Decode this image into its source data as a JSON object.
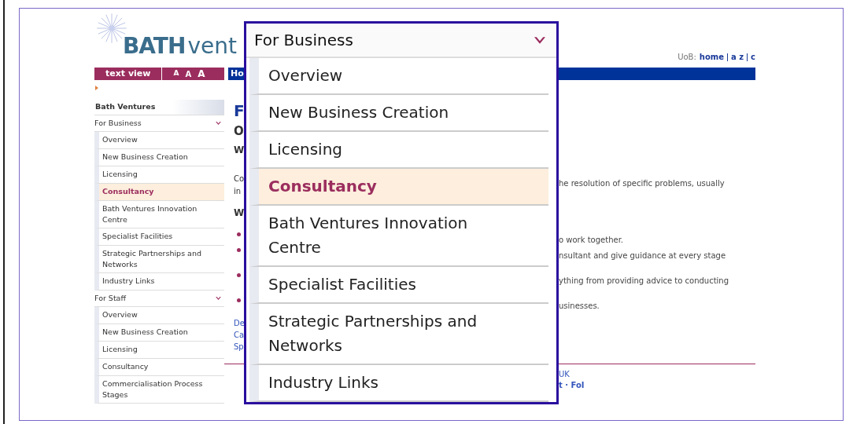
{
  "logo": {
    "strong": "BATH",
    "light": "vent"
  },
  "utility": {
    "label": "UoB:",
    "links": [
      "home",
      "a z",
      "c"
    ]
  },
  "toolbar": {
    "text_view": "text view",
    "sizes": [
      "A",
      "A",
      "A"
    ],
    "nav": "Ho"
  },
  "sidebar": {
    "title": "Bath Ventures",
    "groups": [
      {
        "label": "For Business",
        "expanded": true,
        "children": [
          {
            "label": "Overview",
            "selected": false
          },
          {
            "label": "New Business Creation",
            "selected": false
          },
          {
            "label": "Licensing",
            "selected": false
          },
          {
            "label": "Consultancy",
            "selected": true
          },
          {
            "label": "Bath Ventures Innovation Centre",
            "selected": false
          },
          {
            "label": "Specialist Facilities",
            "selected": false
          },
          {
            "label": "Strategic Partnerships and Networks",
            "selected": false
          },
          {
            "label": "Industry Links",
            "selected": false
          }
        ]
      },
      {
        "label": "For Staff",
        "expanded": true,
        "children": [
          {
            "label": "Overview",
            "selected": false
          },
          {
            "label": "New Business Creation",
            "selected": false
          },
          {
            "label": "Licensing",
            "selected": false
          },
          {
            "label": "Consultancy",
            "selected": false
          },
          {
            "label": "Commercialisation Process Stages",
            "selected": false
          }
        ]
      }
    ]
  },
  "main": {
    "rows": [
      {
        "kind": "title",
        "left": "F"
      },
      {
        "kind": "subtitle",
        "left": "O"
      },
      {
        "kind": "heading",
        "left": "W"
      },
      {
        "kind": "text",
        "left": "Co",
        "right": "he resolution of specific problems, usually"
      },
      {
        "kind": "text",
        "left": "in"
      },
      {
        "kind": "heading",
        "left": "W"
      },
      {
        "kind": "bullet",
        "right": "o work together."
      },
      {
        "kind": "bullet",
        "right": "nsultant and give guidance at every stage"
      },
      {
        "kind": "bullet",
        "right": "ything from providing advice to conducting"
      },
      {
        "kind": "bullet",
        "right": "usinesses."
      },
      {
        "kind": "link",
        "left": "De"
      },
      {
        "kind": "link",
        "left": "Ca"
      },
      {
        "kind": "link",
        "left": "Sp"
      }
    ],
    "footer": [
      "UK",
      "t · FoI"
    ]
  },
  "magnifier": {
    "title": "For Business",
    "items": [
      {
        "label": "Overview",
        "selected": false
      },
      {
        "label": "New Business Creation",
        "selected": false
      },
      {
        "label": "Licensing",
        "selected": false
      },
      {
        "label": "Consultancy",
        "selected": true
      },
      {
        "label": "Bath Ventures Innovation Centre",
        "selected": false
      },
      {
        "label": "Specialist Facilities",
        "selected": false
      },
      {
        "label": "Strategic Partnerships and Networks",
        "selected": false
      },
      {
        "label": "Industry Links",
        "selected": false
      }
    ]
  }
}
